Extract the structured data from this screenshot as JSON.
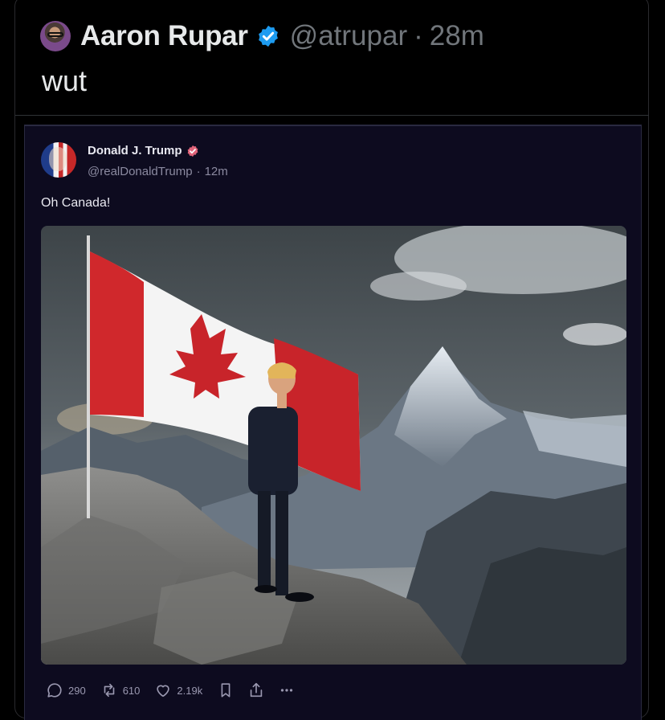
{
  "outer_post": {
    "author_name": "Aaron Rupar",
    "handle": "@atrupar",
    "separator": "·",
    "time": "28m",
    "text": "wut",
    "verified_color": "#1d9bf0"
  },
  "quoted_post": {
    "author_name": "Donald J. Trump",
    "handle": "@realDonaldTrump",
    "separator": "·",
    "time": "12m",
    "text": "Oh Canada!",
    "verified_color": "#e0647a",
    "image_description_icon": "flag-mountain-image"
  },
  "actions": {
    "replies": "290",
    "reposts": "610",
    "likes": "2.19k"
  }
}
